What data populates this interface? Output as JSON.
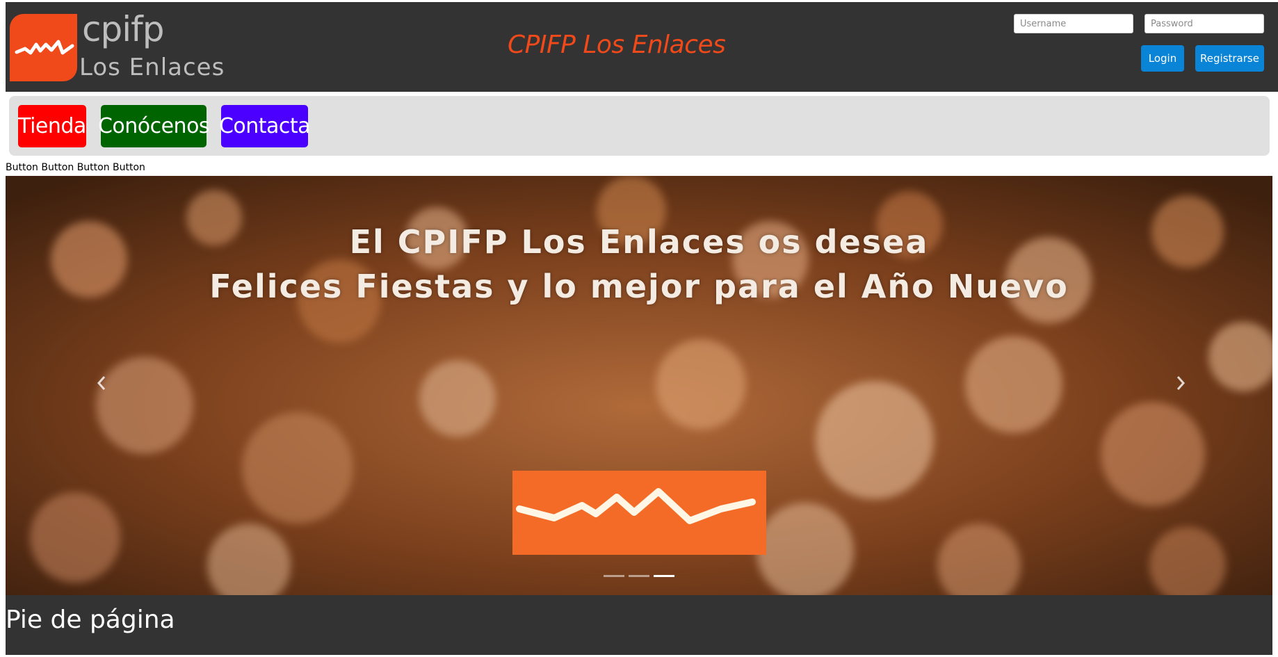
{
  "header": {
    "logo_top": "cpifp",
    "logo_bottom": "Los Enlaces",
    "title": "CPIFP Los Enlaces",
    "username_placeholder": "Username",
    "password_placeholder": "Password",
    "login_label": "Login",
    "register_label": "Registrarse"
  },
  "nav": {
    "items": [
      {
        "label": "Tienda",
        "color": "#ff0000"
      },
      {
        "label": "Conócenos",
        "color": "#006400"
      },
      {
        "label": "Contacta",
        "color": "#4b00ff"
      }
    ]
  },
  "button_text_row": "Button Button Button Button",
  "carousel": {
    "line1": "El CPIFP Los Enlaces os desea",
    "line2": "Felices Fiestas y lo mejor para el Año Nuevo",
    "prev_icon": "chevron-left-icon",
    "next_icon": "chevron-right-icon",
    "indicator_count": 3,
    "active_indicator": 3
  },
  "footer": {
    "text": "Pie de página"
  },
  "colors": {
    "brand_orange": "#f0491a",
    "header_bg": "#333333",
    "button_blue": "#0a84d6",
    "nav_bg": "#e0e0e0"
  }
}
